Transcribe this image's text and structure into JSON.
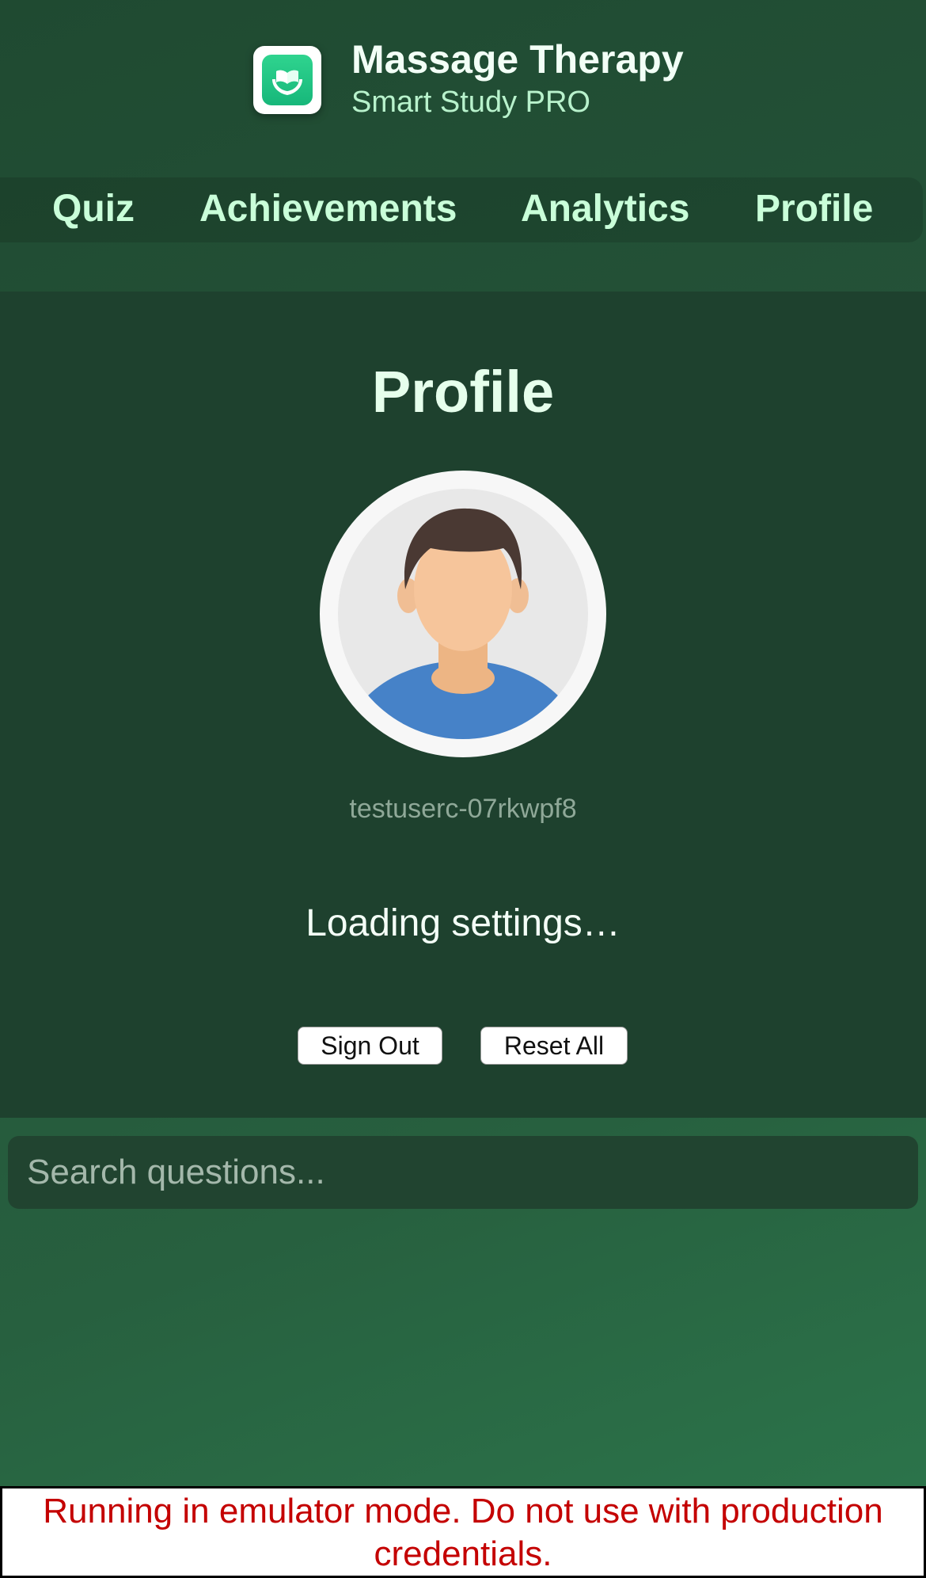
{
  "header": {
    "app_icon": "hands-holding-book-icon",
    "title": "Massage Therapy",
    "subtitle": "Smart Study PRO"
  },
  "nav": {
    "tabs": [
      {
        "label": "Quiz"
      },
      {
        "label": "Achievements"
      },
      {
        "label": "Analytics"
      },
      {
        "label": "Profile"
      }
    ]
  },
  "profile": {
    "title": "Profile",
    "avatar_icon": "person-avatar-icon",
    "username": "testuserc-07rkwpf8",
    "loading_text": "Loading settings…",
    "sign_out_label": "Sign Out",
    "reset_all_label": "Reset All"
  },
  "search": {
    "placeholder": "Search questions..."
  },
  "warning": {
    "text": "Running in emulator mode. Do not use with production credentials."
  },
  "colors": {
    "background": "#245238",
    "panel": "#1e412e",
    "accent_text": "#c9ffd9",
    "app_icon_green": "#1fc480",
    "warning_red": "#c40000"
  }
}
